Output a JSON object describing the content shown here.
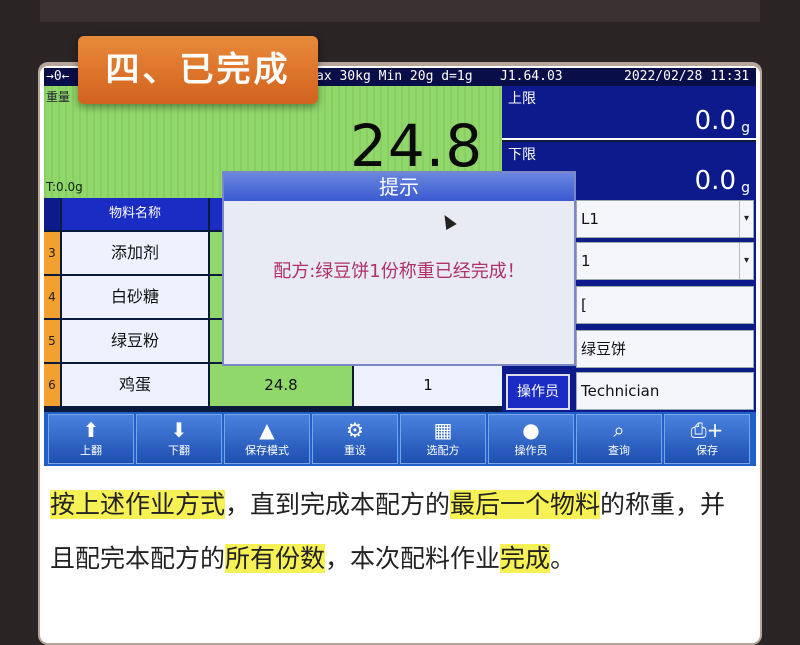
{
  "badge": "四、已完成",
  "status": {
    "zero": "→0←",
    "specs": "ax 30kg Min 20g d=1g",
    "version": "J1.64.03",
    "datetime": "2022/02/28  11:31"
  },
  "weight": {
    "label": "重量",
    "value": "24.8",
    "tare": "T:0.0g"
  },
  "limits": {
    "upper_label": "上限",
    "upper_value": "0.0",
    "lower_label": "下限",
    "lower_value": "0.0",
    "unit": "g"
  },
  "table": {
    "header": "物料名称",
    "rows": [
      {
        "idx": "3",
        "name": "添加剂",
        "v1": "",
        "v2": ""
      },
      {
        "idx": "4",
        "name": "白砂糖",
        "v1": "",
        "v2": ""
      },
      {
        "idx": "5",
        "name": "绿豆粉",
        "v1": "",
        "v2": ""
      },
      {
        "idx": "6",
        "name": "鸡蛋",
        "v1": "24.8",
        "v2": "1"
      }
    ]
  },
  "right": {
    "field1": "L1",
    "field2": "1",
    "field3": "[",
    "field4": "绿豆饼",
    "operator_label": "操作员",
    "operator_value": "Technician"
  },
  "dialog": {
    "title": "提示",
    "message": "配方:绿豆饼1份称重已经完成！"
  },
  "toolbar": [
    {
      "label": "上翻",
      "icon": "arrow-up-icon"
    },
    {
      "label": "下翻",
      "icon": "arrow-down-icon"
    },
    {
      "label": "保存模式",
      "icon": "stack-icon"
    },
    {
      "label": "重设",
      "icon": "gear-icon"
    },
    {
      "label": "选配方",
      "icon": "calendar-icon"
    },
    {
      "label": "操作员",
      "icon": "user-icon"
    },
    {
      "label": "查询",
      "icon": "search-icon"
    },
    {
      "label": "保存",
      "icon": "printer-icon"
    }
  ],
  "caption": {
    "p1": "按上述作业方式",
    "p2": "，直到完成本配方的",
    "p3": "最后一个物料",
    "p4": "的称重，并且配完本配方的",
    "p5": "所有份数",
    "p6": "，本次配料作业",
    "p7": "完成",
    "p8": "。"
  }
}
